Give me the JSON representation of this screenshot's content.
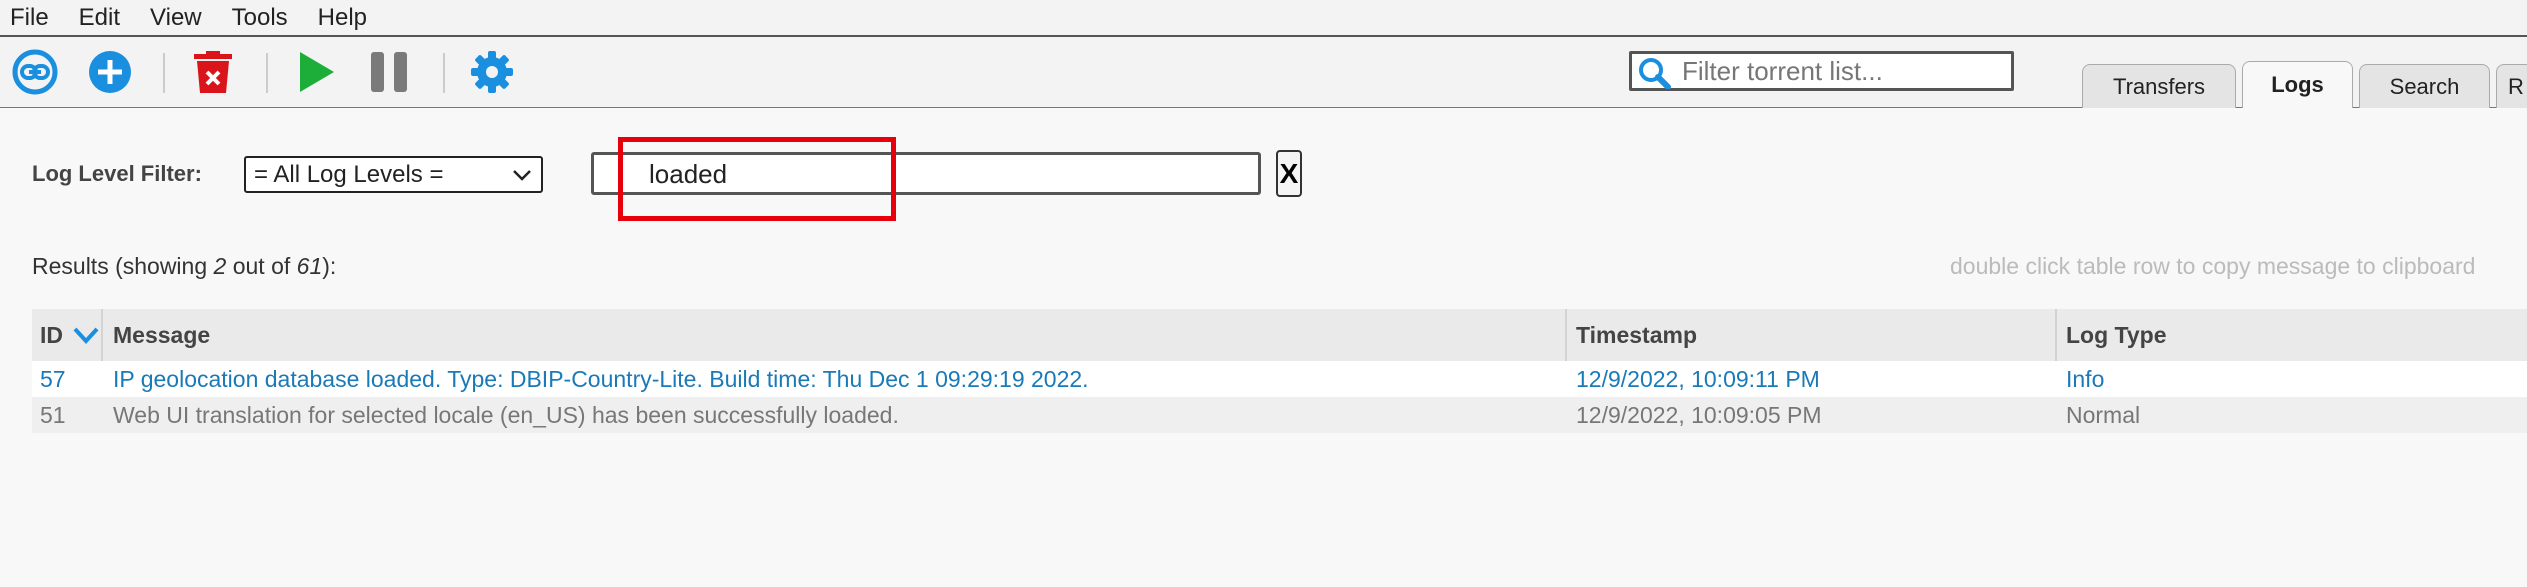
{
  "menu": [
    "File",
    "Edit",
    "View",
    "Tools",
    "Help"
  ],
  "toolbar": {
    "filter_placeholder": "Filter torrent list...",
    "icons": [
      "link-icon",
      "add-icon",
      "delete-icon",
      "play-icon",
      "pause-icon",
      "gear-icon"
    ],
    "accent": "#1a8fe0"
  },
  "tabs": [
    {
      "label": "Transfers",
      "active": false
    },
    {
      "label": "Logs",
      "active": true
    },
    {
      "label": "Search",
      "active": false
    },
    {
      "label": "R",
      "active": false
    }
  ],
  "logs": {
    "level_filter_label": "Log Level Filter:",
    "level_selected": "= All Log Levels =",
    "message_filter_value": "loaded",
    "clear_label": "X",
    "results_prefix": "Results (showing ",
    "results_shown": "2",
    "results_mid": " out of ",
    "results_total": "61",
    "results_suffix": "):",
    "hint": "double click table row to copy message to clipboard"
  },
  "table": {
    "columns": [
      "ID",
      "Message",
      "Timestamp",
      "Log Type"
    ],
    "rows": [
      {
        "id": "57",
        "message": "IP geolocation database loaded. Type: DBIP-Country-Lite. Build time: Thu Dec 1 09:29:19 2022.",
        "timestamp": "12/9/2022, 10:09:11 PM",
        "type": "Info"
      },
      {
        "id": "51",
        "message": "Web UI translation for selected locale (en_US) has been successfully loaded.",
        "timestamp": "12/9/2022, 10:09:05 PM",
        "type": "Normal"
      }
    ]
  }
}
